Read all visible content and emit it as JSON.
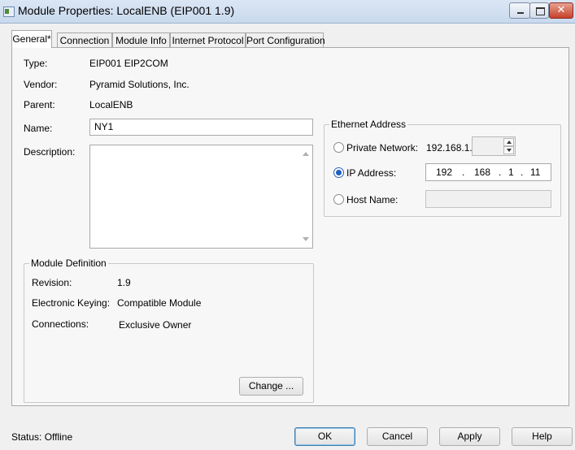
{
  "window": {
    "title": "Module Properties: LocalENB (EIP001 1.9)",
    "controls": {
      "minimize_icon": "minimize-icon",
      "maximize_icon": "maximize-icon",
      "close_glyph": "✕"
    }
  },
  "tabs": [
    {
      "label": "General*",
      "active": true
    },
    {
      "label": "Connection",
      "active": false
    },
    {
      "label": "Module Info",
      "active": false
    },
    {
      "label": "Internet Protocol",
      "active": false
    },
    {
      "label": "Port Configuration",
      "active": false
    }
  ],
  "general": {
    "type_label": "Type:",
    "type_value": "EIP001 EIP2COM",
    "vendor_label": "Vendor:",
    "vendor_value": "Pyramid Solutions, Inc.",
    "parent_label": "Parent:",
    "parent_value": "LocalENB",
    "name_label": "Name:",
    "name_value": "NY1",
    "description_label": "Description:",
    "description_value": ""
  },
  "ethernet": {
    "title": "Ethernet Address",
    "private_network_label": "Private Network:",
    "private_network_prefix": "192.168.1.",
    "private_network_value": "",
    "ip_address_label": "IP Address:",
    "ip_octets": [
      "192",
      "168",
      "1",
      "11"
    ],
    "ip_separator": ".",
    "host_name_label": "Host Name:",
    "host_name_value": "",
    "selected": "ip_address"
  },
  "module_definition": {
    "title": "Module Definition",
    "revision_label": "Revision:",
    "revision_value": "1.9",
    "keying_label": "Electronic Keying:",
    "keying_value": "Compatible Module",
    "connections_label": "Connections:",
    "connections_value": "Exclusive Owner",
    "change_button": "Change ..."
  },
  "footer": {
    "status": "Status:  Offline",
    "ok": "OK",
    "cancel": "Cancel",
    "apply": "Apply",
    "help": "Help"
  },
  "colors": {
    "accent": "#1d5fbf",
    "close_button": "#c7412c"
  }
}
